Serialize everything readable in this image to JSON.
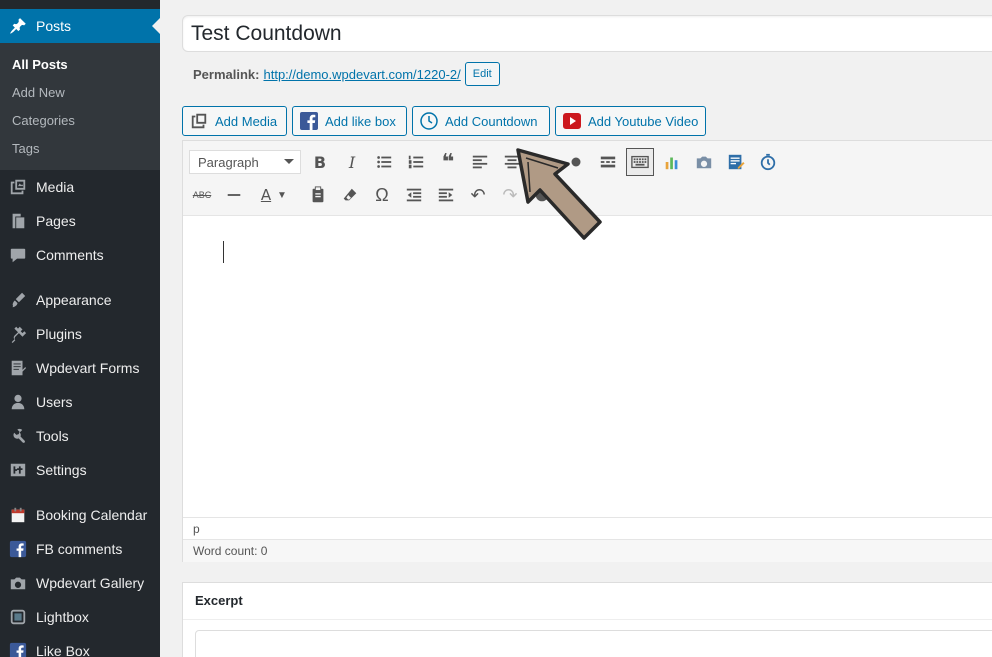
{
  "sidebar": {
    "posts_label": "Posts",
    "submenu": [
      "All Posts",
      "Add New",
      "Categories",
      "Tags"
    ],
    "items": [
      {
        "label": "Media",
        "icon": "media-icon"
      },
      {
        "label": "Pages",
        "icon": "pages-icon"
      },
      {
        "label": "Comments",
        "icon": "comments-icon"
      },
      {
        "label": "Appearance",
        "icon": "appearance-icon"
      },
      {
        "label": "Plugins",
        "icon": "plugins-icon"
      },
      {
        "label": "Wpdevart Forms",
        "icon": "forms-icon"
      },
      {
        "label": "Users",
        "icon": "users-icon"
      },
      {
        "label": "Tools",
        "icon": "tools-icon"
      },
      {
        "label": "Settings",
        "icon": "settings-icon"
      },
      {
        "label": "Booking Calendar",
        "icon": "calendar-icon"
      },
      {
        "label": "FB comments",
        "icon": "facebook-icon"
      },
      {
        "label": "Wpdevart Gallery",
        "icon": "camera-icon"
      },
      {
        "label": "Lightbox",
        "icon": "lightbox-icon"
      },
      {
        "label": "Like Box",
        "icon": "facebook-icon"
      }
    ]
  },
  "post": {
    "title": "Test Countdown",
    "permalink_label": "Permalink:",
    "permalink_url": "http://demo.wpdevart.com/1220-2/",
    "edit_label": "Edit"
  },
  "media_buttons": {
    "add_media": "Add Media",
    "add_like_box": "Add like box",
    "add_countdown": "Add Countdown",
    "add_youtube": "Add Youtube Video"
  },
  "editor": {
    "format_value": "Paragraph",
    "path": "p",
    "word_count": "Word count: 0"
  },
  "excerpt": {
    "title": "Excerpt"
  },
  "colors": {
    "sidebar_bg": "#23282d",
    "accent": "#0073aa",
    "arrow_fill": "#b09a85"
  }
}
